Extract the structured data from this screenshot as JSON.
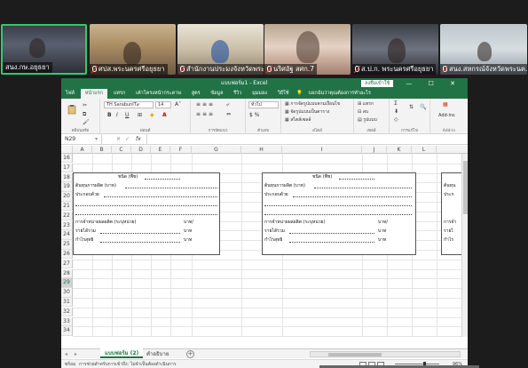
{
  "participants": [
    {
      "name": "สนง.กษ.อยุธยา",
      "muted": false
    },
    {
      "name": "ศปส.พระนครศรีอยุธยา",
      "muted": true
    },
    {
      "name": "สำนักงานประมงจังหวัดพระ...",
      "muted": true
    },
    {
      "name": "นริศอัฐ สศก.7",
      "muted": true
    },
    {
      "name": "ส.ป.ก. พระนครศรีอยุธยา",
      "muted": true
    },
    {
      "name": "สนง.สหกรณ์จังหวัดพระนค...",
      "muted": true
    }
  ],
  "excel": {
    "title": "แบบฟอร์ม1 - Excel",
    "signin": "ลงชื่อเข้าใช้",
    "window_buttons": "— ☐ ✕",
    "tabs": [
      "ไฟล์",
      "หน้าแรก",
      "แทรก",
      "เค้าโครงหน้ากระดาษ",
      "สูตร",
      "ข้อมูล",
      "รีวิว",
      "มุมมอง",
      "วิธีใช้"
    ],
    "active_tab_index": 1,
    "tell_me": "บอกฉันว่าคุณต้องการทำอะไร",
    "ribbon": {
      "font_name": "TH SarabunIT๙",
      "font_size": "14",
      "number_format": "ทั่วไป",
      "groups": [
        "คลิปบอร์ด",
        "ฟอนต์",
        "การจัดแนว",
        "ตัวเลข",
        "สไตล์",
        "เซลล์",
        "การแก้ไข",
        "Add-in"
      ],
      "conditional_formatting": "การจัดรูปแบบตามเงื่อนไข",
      "format_as_table": "จัดรูปแบบเป็นตาราง",
      "cell_styles": "สไตล์เซลล์",
      "insert": "แทรก",
      "delete": "ลบ",
      "format": "รูปแบบ",
      "addins": "Add-ins",
      "bold": "B",
      "italic": "I",
      "underline": "U"
    },
    "name_box": "N29",
    "fx": "fx",
    "columns": [
      "A",
      "B",
      "C",
      "D",
      "E",
      "F",
      "G",
      "H",
      "I",
      "J",
      "K",
      "L"
    ],
    "rows": [
      "16",
      "17",
      "18",
      "19",
      "20",
      "21",
      "22",
      "23",
      "24",
      "25",
      "26",
      "27",
      "28",
      "29",
      "30",
      "31",
      "32",
      "33",
      "34"
    ],
    "form": {
      "title": "ชนิด (พืช)",
      "line1": "ต้นทุนการผลิต (บาท)",
      "line2": "ประกอบด้วย",
      "line3": "การจำหน่ายผลผลิต (ระบุหน่วย)",
      "line3_unit": "บาท/",
      "line4": "รายได้รวม",
      "line4_unit": "บาท",
      "line5": "กำไรสุทธิ",
      "line5_unit": "บาท",
      "partial1": "ต้นทุน",
      "partial2": "ประก",
      "partial3": "การจำ",
      "partial4": "รายไ",
      "partial5": "กำไร"
    },
    "sheets": [
      "แบบฟอร์ม (2)",
      "คำอธิบาย"
    ],
    "status_ready": "พร้อม",
    "accessibility": "การช่วยสำหรับการเข้าถึง: ไม่จำเป็นต้องดำเนินการ",
    "zoom": "96%"
  }
}
